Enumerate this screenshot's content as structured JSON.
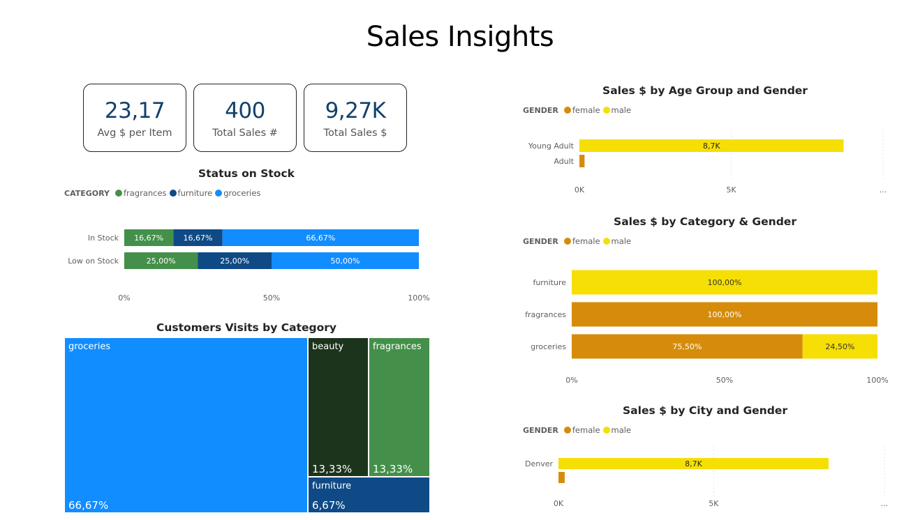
{
  "title": "Sales Insights",
  "kpis": [
    {
      "value": "23,17",
      "label": "Avg $ per Item"
    },
    {
      "value": "400",
      "label": "Total Sales #"
    },
    {
      "value": "9,27K",
      "label": "Total Sales $"
    }
  ],
  "colors": {
    "fragrances": "#44904a",
    "furniture": "#0f4a87",
    "groceries": "#118dff",
    "beauty": "#1c331c",
    "female": "#d68c0a",
    "male": "#f5df05"
  },
  "stock_chart": {
    "title": "Status on Stock",
    "legend_title": "CATEGORY",
    "legend": [
      "fragrances",
      "furniture",
      "groceries"
    ],
    "chart_data": {
      "type": "bar",
      "stacked": "100%",
      "orientation": "horizontal",
      "categories": [
        "In Stock",
        "Low on Stock"
      ],
      "series": [
        {
          "name": "fragrances",
          "values": [
            16.67,
            25.0
          ],
          "labels": [
            "16,67%",
            "25,00%"
          ]
        },
        {
          "name": "furniture",
          "values": [
            16.67,
            25.0
          ],
          "labels": [
            "16,67%",
            "25,00%"
          ]
        },
        {
          "name": "groceries",
          "values": [
            66.67,
            50.0
          ],
          "labels": [
            "66,67%",
            "50,00%"
          ]
        }
      ],
      "xticks": [
        "0%",
        "50%",
        "100%"
      ],
      "xlim": [
        0,
        100
      ]
    }
  },
  "visits_chart": {
    "title": "Customers Visits by Category",
    "chart_data": {
      "type": "treemap",
      "items": [
        {
          "name": "groceries",
          "value": 66.67,
          "label": "66,67%"
        },
        {
          "name": "beauty",
          "value": 13.33,
          "label": "13,33%"
        },
        {
          "name": "fragrances",
          "value": 13.33,
          "label": "13,33%"
        },
        {
          "name": "furniture",
          "value": 6.67,
          "label": "6,67%"
        }
      ]
    }
  },
  "age_chart": {
    "title": "Sales $ by Age Group and Gender",
    "legend_title": "GENDER",
    "legend": [
      "female",
      "male"
    ],
    "chart_data": {
      "type": "bar",
      "orientation": "horizontal",
      "categories": [
        "Young Adult",
        "Adult"
      ],
      "series": [
        {
          "name": "male",
          "values": [
            8700,
            0
          ],
          "labels": [
            "8,7K",
            ""
          ]
        },
        {
          "name": "female",
          "values": [
            0,
            170
          ],
          "labels": [
            "",
            ""
          ]
        }
      ],
      "xticks": [
        "0K",
        "5K",
        "..."
      ],
      "xlim": [
        0,
        10000
      ]
    }
  },
  "category_chart": {
    "title": "Sales $ by Category & Gender",
    "legend_title": "GENDER",
    "legend": [
      "female",
      "male"
    ],
    "chart_data": {
      "type": "bar",
      "stacked": "100%",
      "orientation": "horizontal",
      "categories": [
        "furniture",
        "fragrances",
        "groceries"
      ],
      "series": [
        {
          "name": "female",
          "values": [
            0,
            100,
            75.5
          ],
          "labels": [
            "",
            "100,00%",
            "75,50%"
          ]
        },
        {
          "name": "male",
          "values": [
            100,
            0,
            24.5
          ],
          "labels": [
            "100,00%",
            "",
            "24,50%"
          ]
        }
      ],
      "xticks": [
        "0%",
        "50%",
        "100%"
      ],
      "xlim": [
        0,
        100
      ]
    }
  },
  "city_chart": {
    "title": "Sales $ by City and Gender",
    "legend_title": "GENDER",
    "legend": [
      "female",
      "male"
    ],
    "chart_data": {
      "type": "bar",
      "orientation": "horizontal",
      "categories": [
        "Denver",
        ""
      ],
      "series": [
        {
          "name": "male",
          "values": [
            8700,
            0
          ],
          "labels": [
            "8,7K",
            ""
          ]
        },
        {
          "name": "female",
          "values": [
            0,
            200
          ],
          "labels": [
            "",
            ""
          ]
        }
      ],
      "xticks": [
        "0K",
        "5K",
        "..."
      ],
      "xlim": [
        0,
        10500
      ]
    }
  }
}
